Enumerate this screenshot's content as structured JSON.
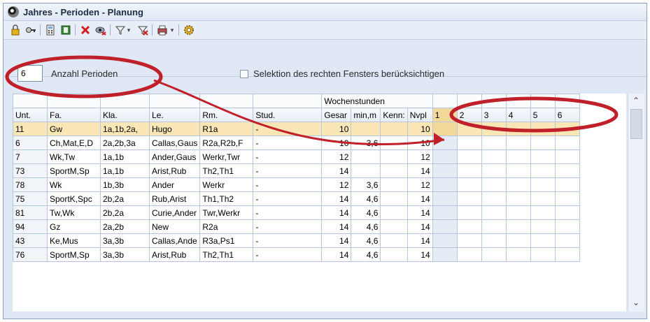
{
  "window": {
    "title": "Jahres - Perioden - Planung"
  },
  "toolbar": {
    "icons": [
      "lock-icon",
      "key-icon",
      "calculator-icon",
      "book-icon",
      "delete-icon",
      "eye-off-icon",
      "filter-icon",
      "filter-clear-icon",
      "print-icon",
      "settings-gear-icon"
    ]
  },
  "options": {
    "periods_value": "6",
    "periods_label": "Anzahl Perioden",
    "selection_label": "Selektion des rechten Fensters berücksichtigen"
  },
  "grid": {
    "group_header": "Wochenstunden",
    "columns": [
      "Unt.",
      "Fa.",
      "Kla.",
      "Le.",
      "Rm.",
      "Stud.",
      "Gesar",
      "min,m",
      "Kenn:",
      "Nvpl",
      "1",
      "2",
      "3",
      "4",
      "5",
      "6"
    ],
    "rows": [
      {
        "unt": "11",
        "fa": "Gw",
        "kla": "1a,1b,2a,",
        "le": "Hugo",
        "rm": "R1a",
        "stud": "-",
        "ges": "10",
        "min": "",
        "kenn": "",
        "nvpl": "10"
      },
      {
        "unt": "6",
        "fa": "Ch,Mat,E,D",
        "kla": "2a,2b,3a",
        "le": "Callas,Gaus",
        "rm": "R2a,R2b,F",
        "stud": "-",
        "ges": "10",
        "min": "3,6",
        "kenn": "",
        "nvpl": "10"
      },
      {
        "unt": "7",
        "fa": "Wk,Tw",
        "kla": "1a,1b",
        "le": "Ander,Gaus",
        "rm": "Werkr,Twr",
        "stud": "-",
        "ges": "12",
        "min": "",
        "kenn": "",
        "nvpl": "12"
      },
      {
        "unt": "73",
        "fa": "SportM,Sp",
        "kla": "1a,1b",
        "le": "Arist,Rub",
        "rm": "Th2,Th1",
        "stud": "-",
        "ges": "14",
        "min": "",
        "kenn": "",
        "nvpl": "14"
      },
      {
        "unt": "78",
        "fa": "Wk",
        "kla": "1b,3b",
        "le": "Ander",
        "rm": "Werkr",
        "stud": "-",
        "ges": "12",
        "min": "3,6",
        "kenn": "",
        "nvpl": "12"
      },
      {
        "unt": "75",
        "fa": "SportK,Spc",
        "kla": "2b,2a",
        "le": "Rub,Arist",
        "rm": "Th1,Th2",
        "stud": "-",
        "ges": "14",
        "min": "4,6",
        "kenn": "",
        "nvpl": "14"
      },
      {
        "unt": "81",
        "fa": "Tw,Wk",
        "kla": "2b,2a",
        "le": "Curie,Ander",
        "rm": "Twr,Werkr",
        "stud": "-",
        "ges": "14",
        "min": "4,6",
        "kenn": "",
        "nvpl": "14"
      },
      {
        "unt": "94",
        "fa": "Gz",
        "kla": "2a,2b",
        "le": "New",
        "rm": "R2a",
        "stud": "-",
        "ges": "14",
        "min": "4,6",
        "kenn": "",
        "nvpl": "14"
      },
      {
        "unt": "43",
        "fa": "Ke,Mus",
        "kla": "3a,3b",
        "le": "Callas,Ande",
        "rm": "R3a,Ps1",
        "stud": "-",
        "ges": "14",
        "min": "4,6",
        "kenn": "",
        "nvpl": "14"
      },
      {
        "unt": "76",
        "fa": "SportM,Sp",
        "kla": "3a,3b",
        "le": "Arist,Rub",
        "rm": "Th2,Th1",
        "stud": "-",
        "ges": "14",
        "min": "4,6",
        "kenn": "",
        "nvpl": "14"
      }
    ]
  },
  "colors": {
    "annotation": "#c0202a",
    "selected_row": "#fbe7b5",
    "period_col": "#e6ecf5"
  }
}
